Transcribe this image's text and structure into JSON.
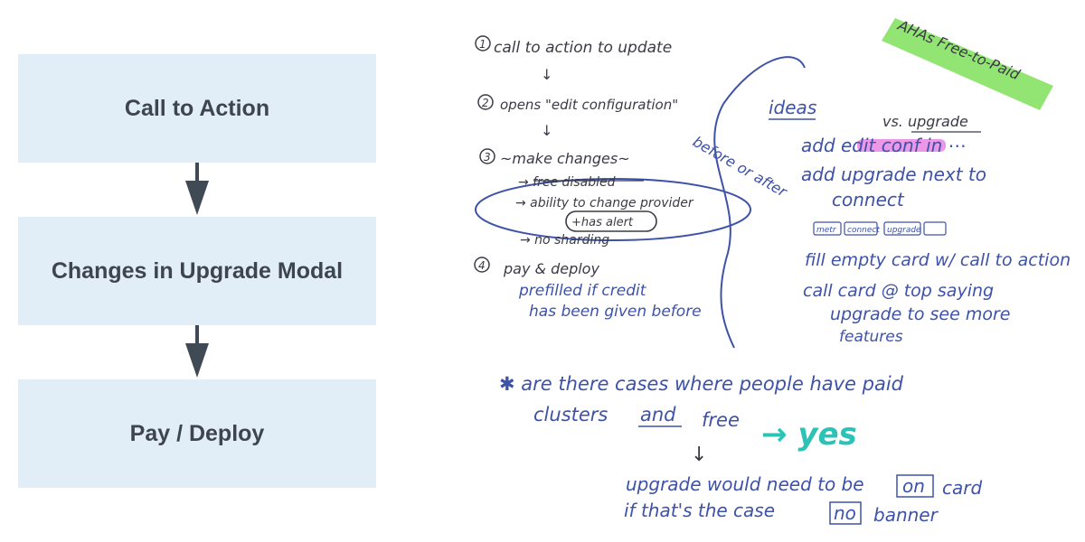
{
  "flow": {
    "steps": [
      "Call to Action",
      "Changes in Upgrade Modal",
      "Pay / Deploy"
    ]
  },
  "notes": {
    "step1": "call to action to update",
    "step2": "opens \"edit configuration\"",
    "step3": "~make changes~",
    "sub_free": "→ free disabled",
    "sub_provider": "→ ability to change provider",
    "has_alert": "+has alert",
    "sub_sharding": "→ no sharding",
    "before_after": "before or after",
    "step4": "pay & deploy",
    "prefilled_1": "prefilled if credit",
    "prefilled_2": "has been given before",
    "ahas": "AHAs Free-to-Paid",
    "ideas": "ideas",
    "vs_upgrade": "vs. upgrade",
    "add_edit": "add edit conf in ⋯",
    "add_upgrade_1": "add upgrade next to",
    "add_upgrade_2": "connect",
    "pill_1": "metr",
    "pill_2": "connect",
    "pill_3": "upgrade",
    "fill_card": "fill empty card w/ call to action",
    "call_card_1": "call card @ top saying",
    "call_card_2": "upgrade to see more",
    "call_card_3": "features",
    "q_1": "✱ are there cases where people have paid",
    "q_2a": "clusters",
    "q_2b": "and",
    "q_2c": "free",
    "yes": "→ yes",
    "down_arrow": "↓",
    "ans_1": "upgrade would need to be",
    "ans_on": "on",
    "ans_card": "card",
    "ans_2": "if that's the case",
    "ans_no": "no",
    "ans_banner": "banner",
    "colors": {
      "box": "#e1eef8",
      "box_text": "#3e4550",
      "arrow": "#3f4a55",
      "pencil": "#3b3b46",
      "ink": "#3d52a8",
      "highlight_green": "#7fe05a",
      "highlight_pink": "#e77ee0",
      "yes": "#2cc2b5"
    }
  }
}
